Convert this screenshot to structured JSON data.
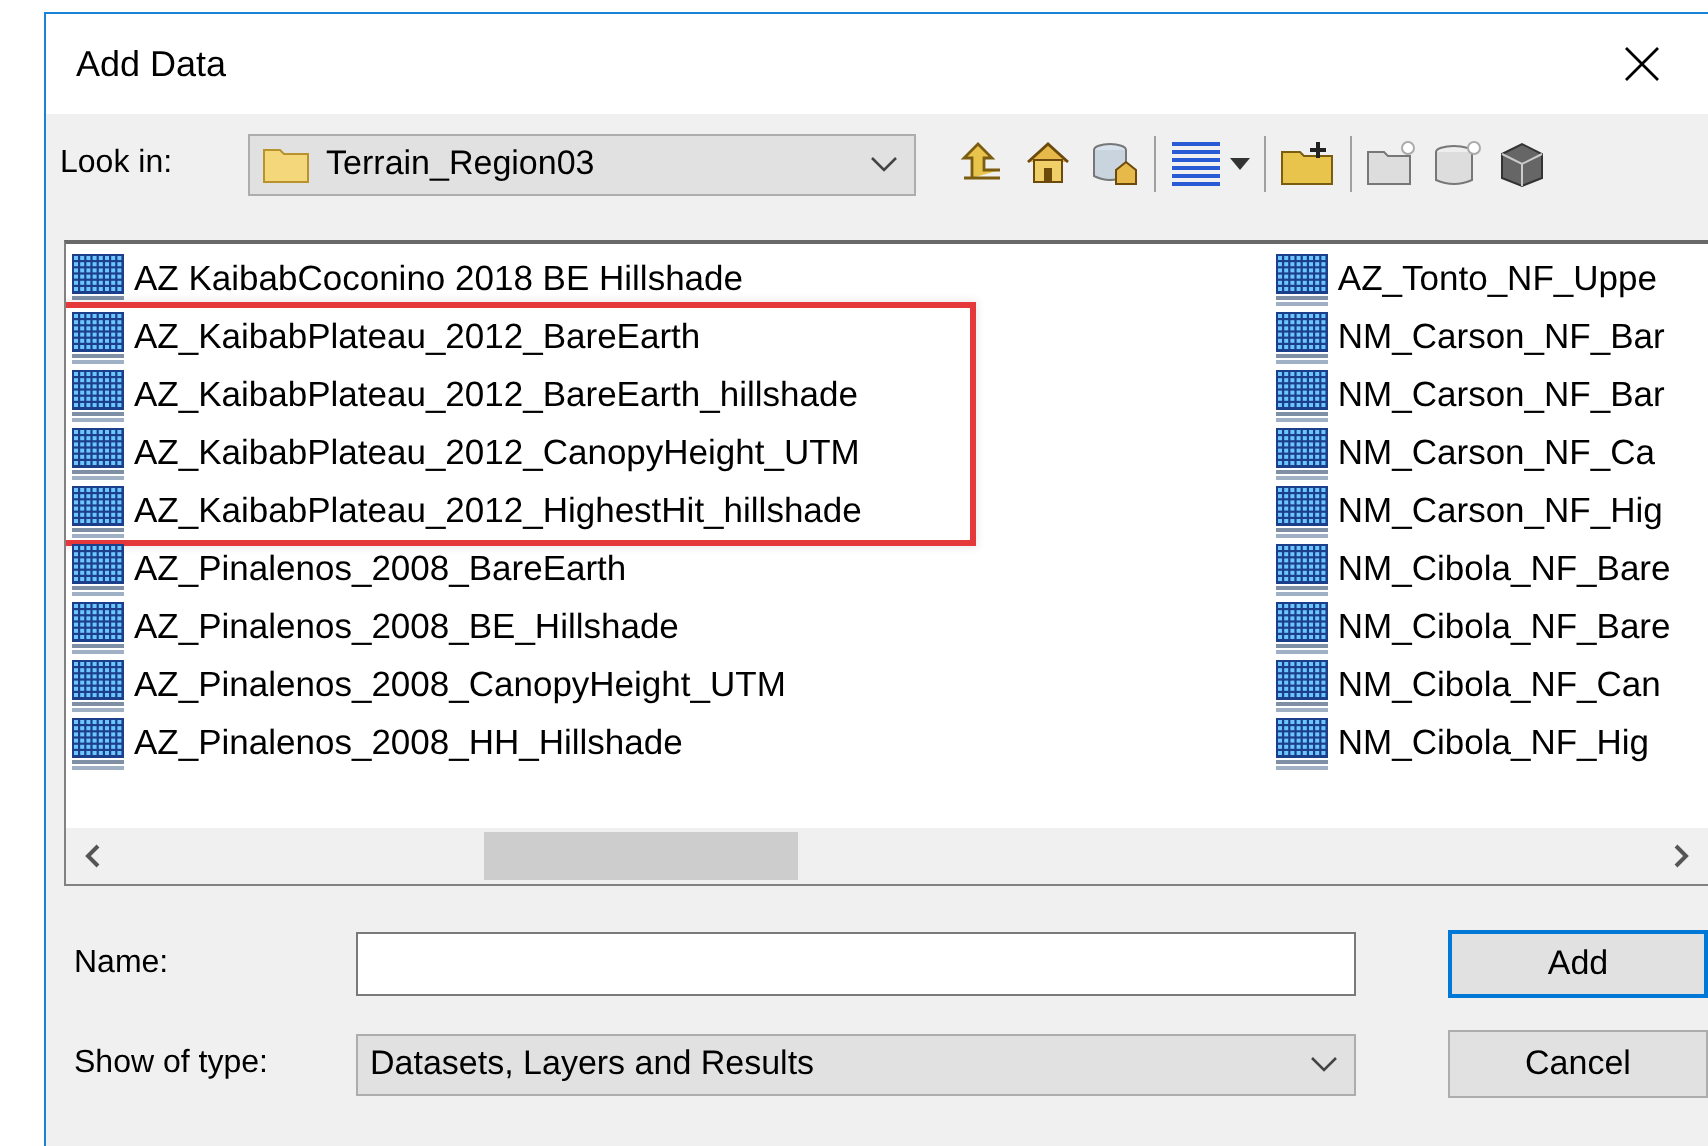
{
  "window": {
    "title": "Add Data"
  },
  "look_in": {
    "label": "Look in:",
    "value": "Terrain_Region03"
  },
  "file_list": {
    "columns": [
      {
        "items": [
          {
            "kind": "file",
            "name": "AZ KaibabCoconino 2018 BE Hillshade"
          },
          {
            "kind": "highlight_group",
            "items": [
              {
                "kind": "file",
                "name": "AZ_KaibabPlateau_2012_BareEarth"
              },
              {
                "kind": "file",
                "name": "AZ_KaibabPlateau_2012_BareEarth_hillshade"
              },
              {
                "kind": "file",
                "name": "AZ_KaibabPlateau_2012_CanopyHeight_UTM"
              },
              {
                "kind": "file",
                "name": "AZ_KaibabPlateau_2012_HighestHit_hillshade"
              }
            ]
          },
          {
            "kind": "file",
            "name": "AZ_Pinalenos_2008_BareEarth"
          },
          {
            "kind": "file",
            "name": "AZ_Pinalenos_2008_BE_Hillshade"
          },
          {
            "kind": "file",
            "name": "AZ_Pinalenos_2008_CanopyHeight_UTM"
          },
          {
            "kind": "file",
            "name": "AZ_Pinalenos_2008_HH_Hillshade"
          }
        ]
      },
      {
        "items": [
          {
            "kind": "file",
            "name": "AZ_Tonto_NF_Uppe"
          },
          {
            "kind": "file",
            "name": "NM_Carson_NF_Bar"
          },
          {
            "kind": "file",
            "name": "NM_Carson_NF_Bar"
          },
          {
            "kind": "file",
            "name": "NM_Carson_NF_Ca"
          },
          {
            "kind": "file",
            "name": "NM_Carson_NF_Hig"
          },
          {
            "kind": "file",
            "name": "NM_Cibola_NF_Bare"
          },
          {
            "kind": "file",
            "name": "NM_Cibola_NF_Bare"
          },
          {
            "kind": "file",
            "name": "NM_Cibola_NF_Can"
          },
          {
            "kind": "file",
            "name": "NM_Cibola_NF_Hig"
          }
        ]
      }
    ]
  },
  "name_field": {
    "label": "Name:"
  },
  "type_field": {
    "label": "Show of type:",
    "value": "Datasets, Layers and Results"
  },
  "buttons": [
    {
      "label": "Add",
      "default": true
    },
    {
      "label": "Cancel",
      "default": false
    }
  ]
}
